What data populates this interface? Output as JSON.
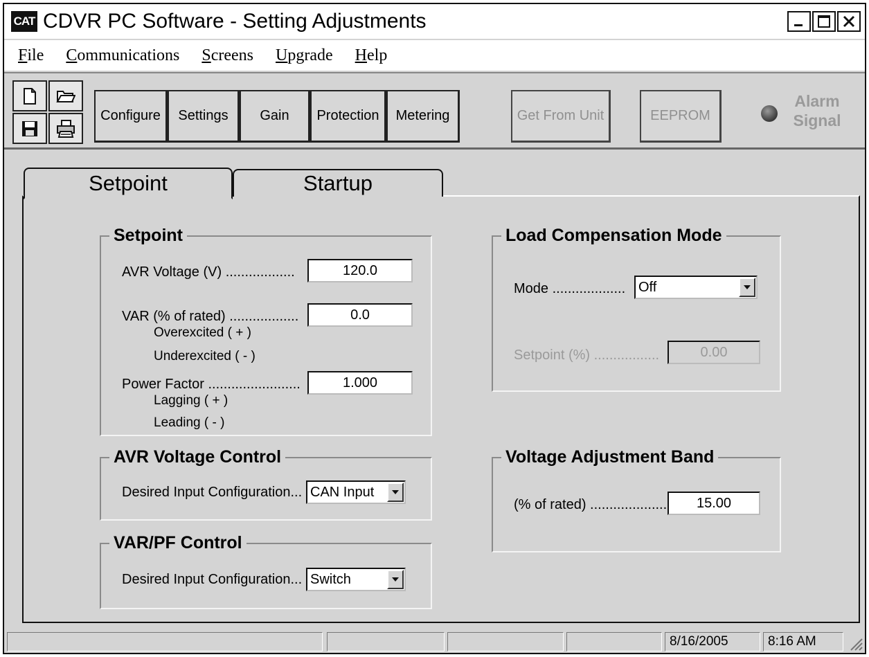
{
  "window": {
    "logo_text": "CAT",
    "title": "CDVR PC Software - Setting Adjustments",
    "minimize_icon": "minimize-icon",
    "maximize_icon": "maximize-icon",
    "close_icon": "close-icon"
  },
  "menu": [
    {
      "first": "F",
      "rest": "ile"
    },
    {
      "first": "C",
      "rest": "ommunications"
    },
    {
      "first": "S",
      "rest": "creens"
    },
    {
      "first": "U",
      "rest": "pgrade"
    },
    {
      "first": "H",
      "rest": "elp"
    }
  ],
  "toolbar": {
    "icons": [
      "new-file-icon",
      "open-folder-icon",
      "save-disk-icon",
      "printer-icon"
    ],
    "buttons": {
      "configure": "Configure",
      "settings": "Settings",
      "gain": "Gain",
      "protection": "Protection",
      "metering": "Metering",
      "get_from_unit": "Get From Unit",
      "eeprom": "EEPROM"
    },
    "alarm_line1": "Alarm",
    "alarm_line2": "Signal"
  },
  "tabs": {
    "setpoint": "Setpoint",
    "startup": "Startup",
    "active": "Setpoint"
  },
  "setpoint_group": {
    "title": "Setpoint",
    "avr_voltage_label": "AVR Voltage (V) ..................",
    "avr_voltage_value": "120.0",
    "var_label": "VAR (% of rated) ..................",
    "var_value": "0.0",
    "overexcited": "Overexcited ( + )",
    "underexcited": "Underexcited ( - )",
    "pf_label": "Power Factor ........................",
    "pf_value": "1.000",
    "lagging": "Lagging ( + )",
    "leading": "Leading ( - )"
  },
  "avr_voltage_control": {
    "title": "AVR Voltage Control",
    "label": "Desired Input Configuration...",
    "value": "CAN Input"
  },
  "var_pf_control": {
    "title": "VAR/PF Control",
    "label": "Desired Input Configuration...",
    "value": "Switch"
  },
  "load_compensation": {
    "title": "Load Compensation Mode",
    "mode_label": "Mode ...................",
    "mode_value": "Off",
    "setpoint_label": "Setpoint (%) .................",
    "setpoint_value": "0.00"
  },
  "voltage_adjustment": {
    "title": "Voltage Adjustment Band",
    "label": "(% of rated) .....................",
    "value": "15.00"
  },
  "statusbar": {
    "date": "8/16/2005",
    "time": "8:16 AM"
  },
  "colors": {
    "window_bg": "#d4d4d4",
    "disabled_text": "#9a9a9a"
  }
}
